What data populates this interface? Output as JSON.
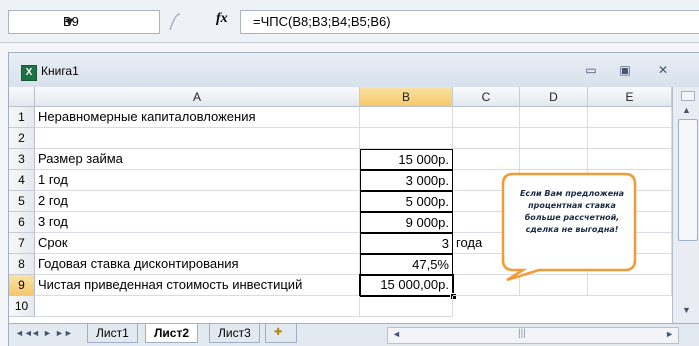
{
  "formula_bar": {
    "name_box": "B9",
    "fx_label": "fx",
    "formula": "=ЧПС(B8;B3;B4;B5;B6)"
  },
  "window": {
    "title": "Книга1",
    "icon": "excel-icon",
    "minimize": "▭",
    "restore": "▣",
    "close": "✕"
  },
  "grid": {
    "columns": [
      "A",
      "B",
      "C",
      "D",
      "E"
    ],
    "selected_column": "B",
    "selected_row": "9",
    "rows": [
      {
        "num": "1",
        "a": "Неравномерные капиталовложения",
        "b": "",
        "c": ""
      },
      {
        "num": "2",
        "a": "",
        "b": "",
        "c": ""
      },
      {
        "num": "3",
        "a": "Размер займа",
        "b": "15 000р.",
        "c": ""
      },
      {
        "num": "4",
        "a": "1 год",
        "b": "3 000р.",
        "c": ""
      },
      {
        "num": "5",
        "a": "2 год",
        "b": "5 000р.",
        "c": ""
      },
      {
        "num": "6",
        "a": "3 год",
        "b": "9 000р.",
        "c": ""
      },
      {
        "num": "7",
        "a": "Срок",
        "b": "3",
        "c": "года"
      },
      {
        "num": "8",
        "a": "Годовая ставка дисконтирования",
        "b": "47,5%",
        "c": ""
      },
      {
        "num": "9",
        "a": "Чистая приведенная стоимость инвестиций",
        "b": "15 000,00р.",
        "c": ""
      },
      {
        "num": "10",
        "a": "",
        "b": "",
        "c": ""
      }
    ]
  },
  "callout": {
    "text": "Если Вам предложена процентная ставка больше рассчетной, сделка не выгодна!",
    "colors": {
      "fill": "#ffffff",
      "stroke": "#f39a35"
    }
  },
  "sheet_tabs": {
    "nav": [
      "◄◄",
      "◄",
      "►",
      "►►"
    ],
    "tabs": [
      "Лист1",
      "Лист2",
      "Лист3"
    ],
    "active": "Лист2",
    "new_sheet_icon": "new-sheet-icon"
  }
}
